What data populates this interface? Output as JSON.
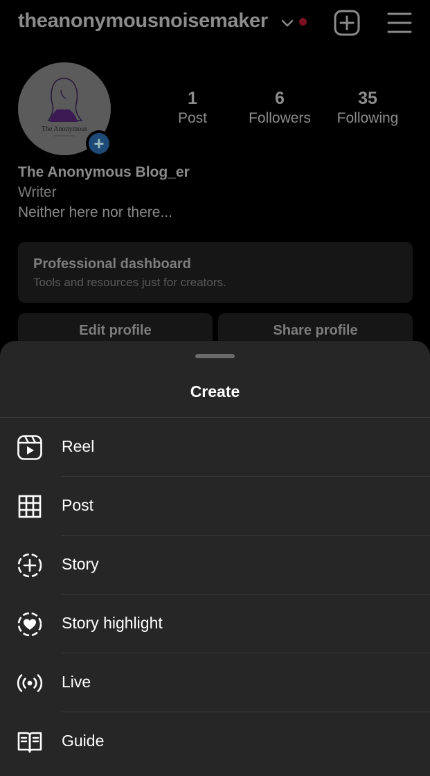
{
  "header": {
    "username": "theanonymousnoisemaker",
    "icons": [
      "chevron-down-icon",
      "notification-dot",
      "new-post-icon",
      "menu-icon"
    ]
  },
  "profile": {
    "avatar_caption": "The Anonymous",
    "stats": [
      {
        "num": "1",
        "label": "Post"
      },
      {
        "num": "6",
        "label": "Followers"
      },
      {
        "num": "35",
        "label": "Following"
      }
    ],
    "name": "The Anonymous Blog_er",
    "category": "Writer",
    "bio": "Neither here nor there...",
    "dashboard": {
      "title": "Professional dashboard",
      "subtitle": "Tools and resources just for creators."
    },
    "buttons": {
      "edit": "Edit profile",
      "share": "Share profile"
    }
  },
  "sheet": {
    "title": "Create",
    "items": [
      {
        "label": "Reel",
        "icon": "reel-icon"
      },
      {
        "label": "Post",
        "icon": "grid-icon"
      },
      {
        "label": "Story",
        "icon": "story-add-icon"
      },
      {
        "label": "Story highlight",
        "icon": "highlight-heart-icon"
      },
      {
        "label": "Live",
        "icon": "live-icon"
      },
      {
        "label": "Guide",
        "icon": "guide-book-icon"
      }
    ]
  },
  "colors": {
    "background": "#000000",
    "sheet": "#262626",
    "notification_dot": "#7a1020",
    "add_story_badge": "#1e4a78"
  }
}
